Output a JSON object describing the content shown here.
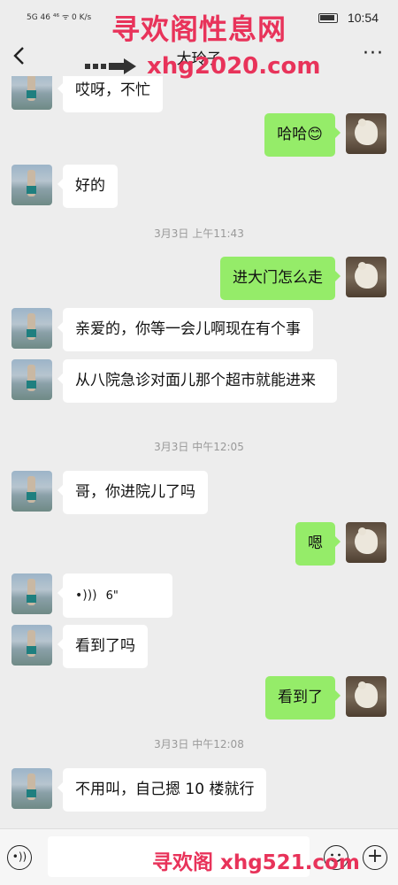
{
  "status_bar": {
    "left": "5G 46 ⁴⁶ ᯤ 0 K/s",
    "time": "10:54"
  },
  "header": {
    "back_icon": "chevron-left-icon",
    "title": "大玲子",
    "more_icon": "ellipsis-icon"
  },
  "watermarks": {
    "top": "寻欢阁性息网",
    "url": "xhg2020.com",
    "bottom": "寻欢阁 xhg521.com"
  },
  "messages": [
    {
      "side": "left",
      "text": "哎呀，不忙"
    },
    {
      "side": "right",
      "text": "哈哈😊"
    },
    {
      "side": "left",
      "text": "好的"
    },
    {
      "type": "time",
      "text": "3月3日 上午11:43"
    },
    {
      "side": "right",
      "text": "进大门怎么走"
    },
    {
      "side": "left",
      "text": "亲爱的，你等一会儿啊现在有个事"
    },
    {
      "side": "left",
      "text": "从八院急诊对面儿那个超市就能进来"
    },
    {
      "type": "time",
      "text": "3月3日 中午12:05"
    },
    {
      "side": "left",
      "text": "哥，你进院儿了吗"
    },
    {
      "side": "right",
      "text": "嗯"
    },
    {
      "side": "left",
      "type": "voice",
      "duration": "6\""
    },
    {
      "side": "left",
      "text": "看到了吗"
    },
    {
      "side": "right",
      "text": "看到了"
    },
    {
      "type": "time",
      "text": "3月3日 中午12:08"
    },
    {
      "side": "left",
      "text": "不用叫，自己摁 10 楼就行"
    }
  ],
  "input_bar": {
    "voice_icon": "voice-icon",
    "emoji_icon": "emoji-icon",
    "plus_icon": "plus-icon"
  }
}
